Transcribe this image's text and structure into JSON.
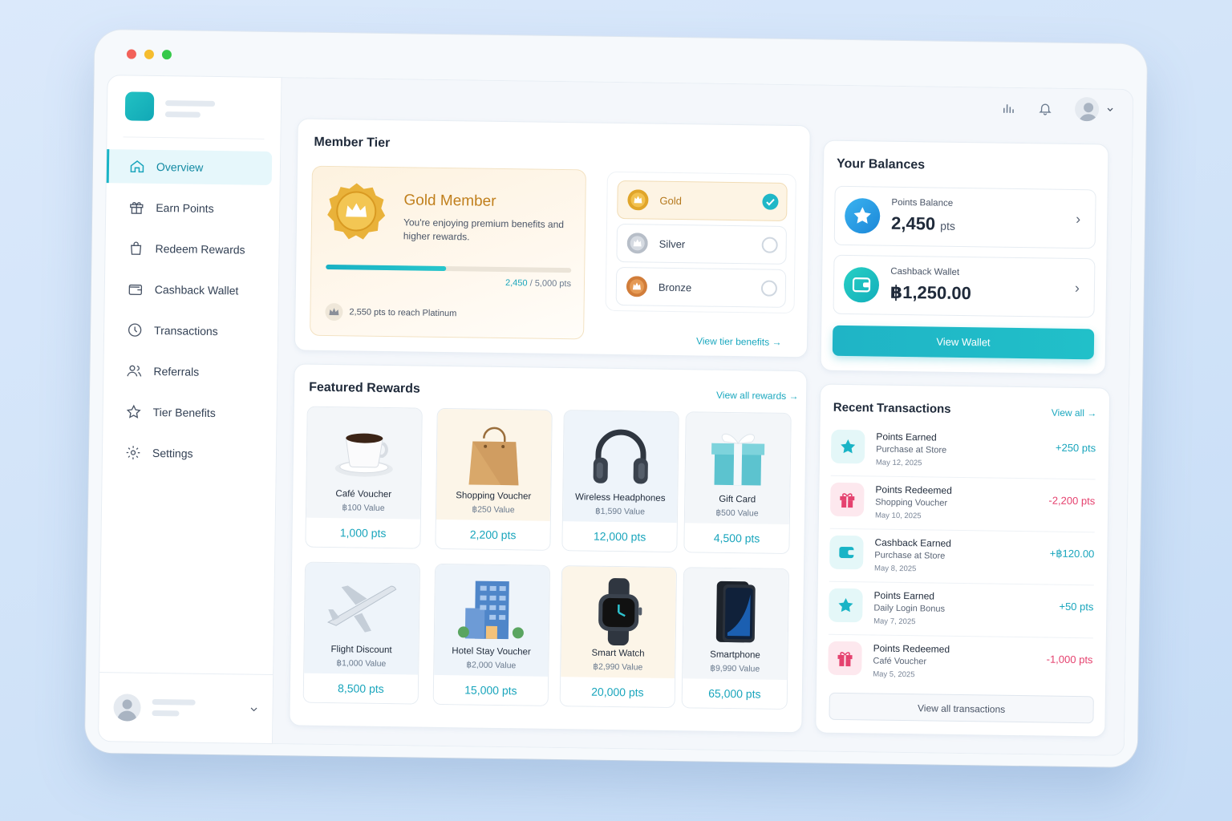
{
  "window": {
    "controls": [
      "close",
      "minimize",
      "maximize"
    ]
  },
  "sidebar": {
    "items": [
      {
        "label": "Overview",
        "icon": "home-icon",
        "active": true
      },
      {
        "label": "Earn Points",
        "icon": "gift-icon"
      },
      {
        "label": "Redeem Rewards",
        "icon": "shopping-bag-icon"
      },
      {
        "label": "Cashback Wallet",
        "icon": "wallet-icon"
      },
      {
        "label": "Transactions",
        "icon": "clock-icon"
      },
      {
        "label": "Referrals",
        "icon": "users-icon"
      },
      {
        "label": "Tier Benefits",
        "icon": "star-icon"
      },
      {
        "label": "Settings",
        "icon": "gear-icon"
      }
    ]
  },
  "topbar": {
    "icons": [
      "chart-icon",
      "bell-icon",
      "avatar",
      "chevron-down-icon"
    ]
  },
  "member_tier": {
    "title": "Member Tier",
    "current": "Gold Member",
    "description": "You're enjoying premium benefits and higher rewards.",
    "progress_current": "2,450",
    "progress_total": "/ 5,000 pts",
    "progress_fraction": 0.49,
    "next_tier_note": "2,550 pts to reach Platinum",
    "options": [
      {
        "label": "Gold",
        "selected": true,
        "color": "#e0a52a"
      },
      {
        "label": "Silver",
        "selected": false,
        "color": "#b7bec8"
      },
      {
        "label": "Bronze",
        "selected": false,
        "color": "#d17d3a"
      }
    ],
    "benefits_link": "View tier benefits →"
  },
  "featured": {
    "title": "Featured Rewards",
    "link": "View all rewards →",
    "items": [
      {
        "name": "Café Voucher",
        "value": "฿100 Value",
        "pts": "1,000 pts",
        "icon": "coffee-cup-icon"
      },
      {
        "name": "Shopping Voucher",
        "value": "฿250 Value",
        "pts": "2,200 pts",
        "icon": "shopping-bag-icon"
      },
      {
        "name": "Wireless Headphones",
        "value": "฿1,590 Value",
        "pts": "12,000 pts",
        "icon": "headphones-icon"
      },
      {
        "name": "Gift Card",
        "value": "฿500 Value",
        "pts": "4,500 pts",
        "icon": "gift-box-icon"
      },
      {
        "name": "Flight Discount",
        "value": "฿1,000 Value",
        "pts": "8,500 pts",
        "icon": "airplane-icon"
      },
      {
        "name": "Hotel Stay Voucher",
        "value": "฿2,000 Value",
        "pts": "15,000 pts",
        "icon": "hotel-icon"
      },
      {
        "name": "Smart Watch",
        "value": "฿2,990 Value",
        "pts": "20,000 pts",
        "icon": "smartwatch-icon"
      },
      {
        "name": "Smartphone",
        "value": "฿9,990 Value",
        "pts": "65,000 pts",
        "icon": "smartphone-icon"
      }
    ]
  },
  "balances": {
    "title": "Your Balances",
    "points_label": "Points Balance",
    "points_value": "2,450",
    "points_unit": "pts",
    "wallet_label": "Cashback Wallet",
    "wallet_value": "฿1,250.00",
    "button": "View Wallet"
  },
  "transactions": {
    "title": "Recent Transactions",
    "link": "View all →",
    "items": [
      {
        "title": "Points Earned",
        "detail": "Purchase at Store",
        "date": "May 12, 2025",
        "amount": "+250 pts",
        "kind": "earn"
      },
      {
        "title": "Points Redeemed",
        "detail": "Shopping Voucher",
        "date": "May 10, 2025",
        "amount": "-2,200 pts",
        "kind": "redeem"
      },
      {
        "title": "Cashback Earned",
        "detail": "Purchase at Store",
        "date": "May 8, 2025",
        "amount": "+฿120.00",
        "kind": "cashback"
      },
      {
        "title": "Points Earned",
        "detail": "Daily Login Bonus",
        "date": "May 7, 2025",
        "amount": "+50 pts",
        "kind": "earn"
      },
      {
        "title": "Points Redeemed",
        "detail": "Café Voucher",
        "date": "May 5, 2025",
        "amount": "-1,000 pts",
        "kind": "redeem"
      }
    ],
    "view_all_button": "View all transactions"
  },
  "colors": {
    "accent": "#19b4c6",
    "gold": "#e0a52a",
    "positive": "#19a5bc",
    "negative": "#e5426f"
  }
}
